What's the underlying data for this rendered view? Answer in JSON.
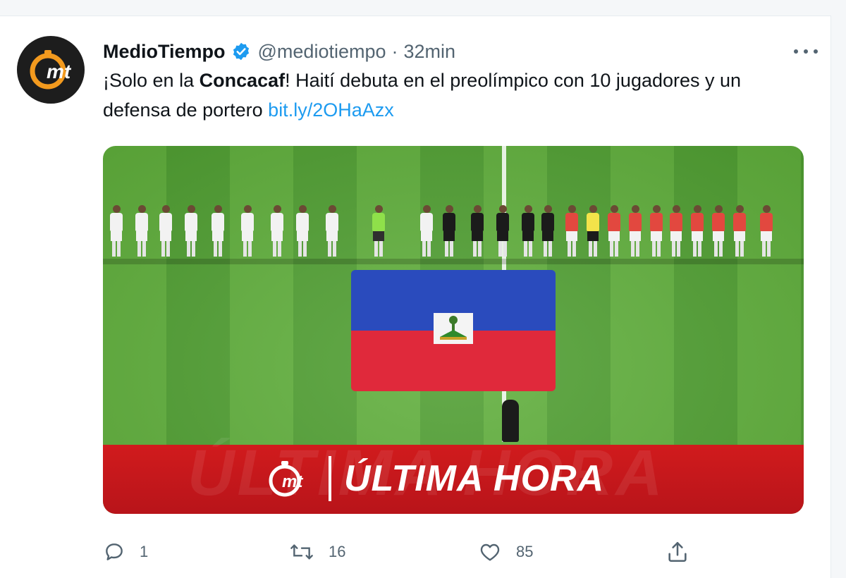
{
  "tweet": {
    "author_name": "MedioTiempo",
    "handle": "@mediotiempo",
    "separator": "·",
    "time": "32min",
    "avatar_logo_text": "mt",
    "text_before": "¡Solo en la ",
    "text_bold": "Concacaf",
    "text_after": "! Haití debuta en el preolímpico con 10 jugadores y un defensa de portero ",
    "link": "bit.ly/2OHaAzx"
  },
  "media": {
    "banner_title": "ÚLTIMA HORA",
    "banner_logo_text": "mt",
    "flag_colors": {
      "blue": "#2a4bbd",
      "red": "#e0293b"
    }
  },
  "actions": {
    "reply_count": "1",
    "retweet_count": "16",
    "like_count": "85"
  },
  "colors": {
    "accent_link": "#1d9bf0",
    "verified": "#1d9bf0",
    "muted": "#536471",
    "banner_red": "#d11b1d"
  },
  "icons": [
    "verified-badge-icon",
    "more-options-icon",
    "reply-icon",
    "retweet-icon",
    "like-icon",
    "share-icon"
  ]
}
